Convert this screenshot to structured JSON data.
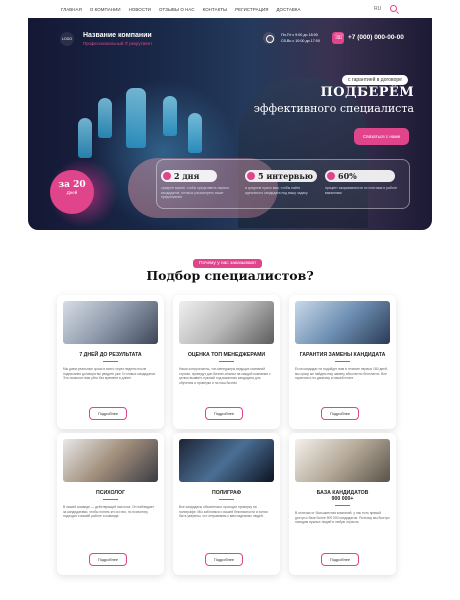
{
  "nav": [
    "ГЛАВНАЯ",
    "О КОМПАНИИ",
    "НОВОСТИ",
    "ОТЗЫВЫ О НАС",
    "КОНТАКТЫ",
    "РЕГИСТРАЦИЯ",
    "ДОСТАВКА"
  ],
  "nav_flag": "RU",
  "header": {
    "logo": "LOGO",
    "company_name": "Название компании",
    "company_sub": "Профессиональный IT рекрутмент",
    "hours1": "Пн-Пт с 9:00 до 18:00",
    "hours2": "Сб-Вс с 10:00 до 17:00",
    "phone": "+7 (000) 000-00-00"
  },
  "hero": {
    "guarantee": "с гарантией в договоре",
    "title1": "ПОДБЕРЁМ",
    "title2": "эффективного специалиста",
    "cta": "Связаться с нами",
    "badge_big": "за 20",
    "badge_small": "Дней"
  },
  "stats": [
    {
      "value": "2 дня",
      "desc": "среднее время, чтобы представить первых кандидатов, готовых рассмотреть ваше предложение"
    },
    {
      "value": "5 интервью",
      "desc": "в среднем нужно вам, чтобы найти идеального кандидата под вашу задачу"
    },
    {
      "value": "60%",
      "desc": "процент закрываемости по плотным в работе вакансиям"
    }
  ],
  "section": {
    "why": "Почему у нас заказывают",
    "title": "Подбор специалистов?"
  },
  "cards": [
    {
      "title": "7 ДНЕЙ ДО РЕЗУЛЬТАТА",
      "title2": "",
      "desc": "Мы даем реальные сроки и всего через неделю после подписания договора вы увидите уже 3 готовых кандидатов. Это позволит вам уйти без времени в длинн",
      "more": "Подробнее"
    },
    {
      "title": "ОЦЕНКА ТОП МЕНЕДЖЕРАМИ",
      "title2": "",
      "desc": "Наши консультанты, топ-менеджеры ведущих компаний страны, проведут доп-бизнес-анализ на каждой компании с целью выявить нужный под вакансию кандидата для обучения и проверки и на наш бизнес",
      "more": "Подробнее"
    },
    {
      "title": "ГАРАНТИЯ ЗАМЕНЫ КАНДИДАТА",
      "title2": "",
      "desc": "Если кандидат не подойдет вам в течение первых 180 дней, мы сразу же найдем ему замену абсолютно бесплатно. Все гарантии и по данному в нашей плате",
      "more": "Подробнее"
    },
    {
      "title": "ПСИХОЛОГ",
      "title2": "",
      "desc": "В нашей команде — действующий психолог. Он наблюдает за кандидатами, чтобы понять кто из них, по психотипу, подходит к вашей работе и команде.",
      "more": "Подробнее"
    },
    {
      "title": "ПОЛИГРАФ",
      "title2": "",
      "desc": "Все кандидаты обязательно проходят проверку на полиграфе. Мы заботимся о вашей безопасности и хотим быть уверены, что отправляем к вам надежных людей.",
      "more": "Подробнее"
    },
    {
      "title": "БАЗА КАНДИДАТОВ",
      "title2": "900 000+",
      "desc": "В отличии от большинства компаний, у нас есть прямой доступ к базе более 900 000 кандидатов. Поэтому мы быстро находим нужных людей в любую отрасль.",
      "more": "Подробнее"
    }
  ],
  "colors": {
    "accent": "#e0458b",
    "hero_dark": "#141734"
  }
}
